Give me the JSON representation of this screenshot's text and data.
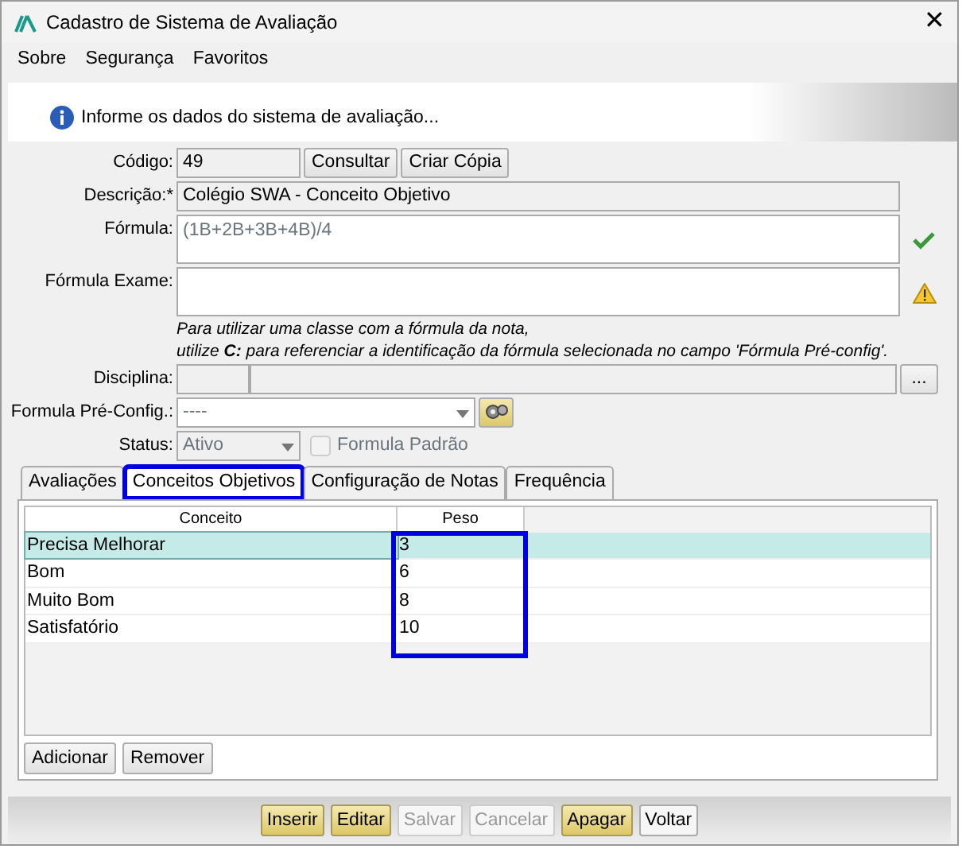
{
  "window": {
    "title": "Cadastro de Sistema de Avaliação",
    "close": "✕"
  },
  "menu": [
    "Sobre",
    "Segurança",
    "Favoritos"
  ],
  "info": "Informe os dados do sistema de avaliação...",
  "codigo": {
    "label": "Código:",
    "value": "49",
    "buttons": [
      "Consultar",
      "Criar Cópia"
    ]
  },
  "descricao": {
    "label": "Descrição:*",
    "value": "Colégio SWA - Conceito Objetivo"
  },
  "formula": {
    "label": "Fórmula:",
    "value": "(1B+2B+3B+4B)/4",
    "valid": true
  },
  "formula_exame": {
    "label": "Fórmula Exame:",
    "valid": false
  },
  "note": [
    "Para utilizar uma classe com a fórmula da nota,",
    "utilize **C:** para referenciar a identificação da fórmula selecionada no campo *'Fórmula Pré-config'*."
  ],
  "disciplina": {
    "label": "Disciplina:",
    "button": "..."
  },
  "pre_config": {
    "label": "Formula Pré-Config.:",
    "value": "----"
  },
  "status": {
    "label": "Status:",
    "value": "Ativo",
    "checkbox": {
      "label": "Formula Padrão",
      "checked": false,
      "disabled": true
    }
  },
  "tabs": [
    {
      "label": "Avaliações",
      "selected": false,
      "highlighted": false
    },
    {
      "label": "Conceitos Objetivos",
      "selected": true,
      "highlighted": true
    },
    {
      "label": "Configuração de Notas",
      "selected": false,
      "highlighted": false
    },
    {
      "label": "Frequência",
      "selected": false,
      "highlighted": false
    }
  ],
  "table": {
    "columns": [
      {
        "label": "Conceito",
        "highlighted": false
      },
      {
        "label": "Peso",
        "highlighted": true
      }
    ],
    "rows": [
      {
        "cells": [
          "Precisa Melhorar",
          "3"
        ],
        "selected": true
      },
      {
        "cells": [
          "Bom",
          "6"
        ],
        "selected": false
      },
      {
        "cells": [
          "Muito Bom",
          "8"
        ],
        "selected": false
      },
      {
        "cells": [
          "Satisfatório",
          "10"
        ],
        "selected": false
      }
    ]
  },
  "table_buttons": [
    "Adicionar",
    "Remover"
  ],
  "footer_buttons": [
    {
      "label": "Inserir",
      "kind": "accent",
      "disabled": false
    },
    {
      "label": "Editar",
      "kind": "accent",
      "disabled": false
    },
    {
      "label": "Salvar",
      "kind": "plain",
      "disabled": true
    },
    {
      "label": "Cancelar",
      "kind": "plain",
      "disabled": true
    },
    {
      "label": "Apagar",
      "kind": "accent",
      "disabled": false
    },
    {
      "label": "Voltar",
      "kind": "plain",
      "disabled": false
    }
  ]
}
